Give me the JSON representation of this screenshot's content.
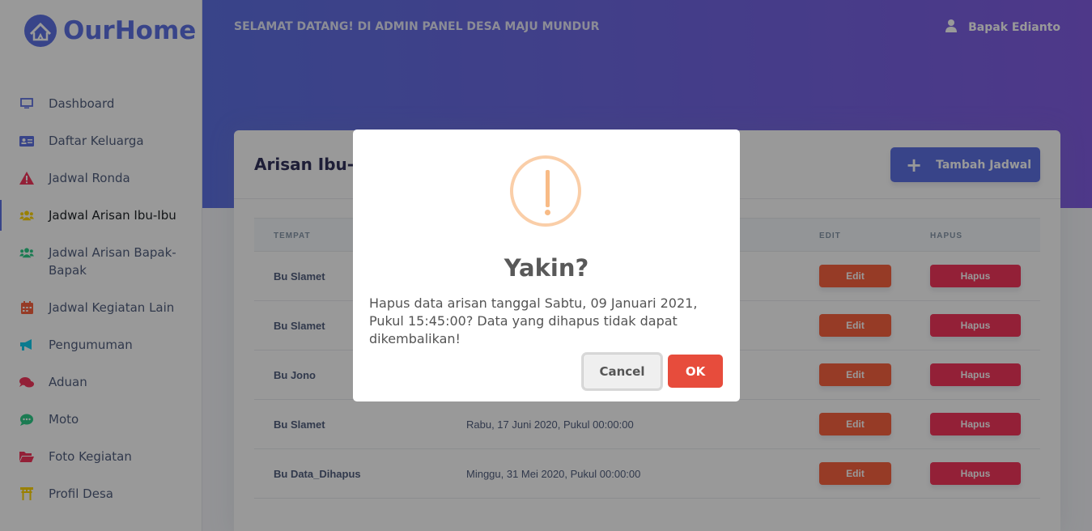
{
  "brand": {
    "name": "OurHome"
  },
  "header": {
    "welcome": "SELAMAT DATANG! DI ADMIN PANEL DESA MAJU MUNDUR",
    "user_name": "Bapak Edianto"
  },
  "sidebar": {
    "items": [
      {
        "label": "Dashboard",
        "icon": "monitor-icon",
        "color": "#5e72e4"
      },
      {
        "label": "Daftar Keluarga",
        "icon": "id-card-icon",
        "color": "#5e72e4"
      },
      {
        "label": "Jadwal Ronda",
        "icon": "warning-icon",
        "color": "#f5365c"
      },
      {
        "label": "Jadwal Arisan Ibu-Ibu",
        "icon": "users-icon",
        "color": "#ffd600"
      },
      {
        "label": "Jadwal Arisan Bapak-Bapak",
        "icon": "users-icon",
        "color": "#2dce89"
      },
      {
        "label": "Jadwal Kegiatan Lain",
        "icon": "calendar-icon",
        "color": "#fb6340"
      },
      {
        "label": "Pengumuman",
        "icon": "megaphone-icon",
        "color": "#11cdef"
      },
      {
        "label": "Aduan",
        "icon": "comments-icon",
        "color": "#f5365c"
      },
      {
        "label": "Moto",
        "icon": "comment-dots-icon",
        "color": "#2dce89"
      },
      {
        "label": "Foto Kegiatan",
        "icon": "folder-open-icon",
        "color": "#f5365c"
      },
      {
        "label": "Profil Desa",
        "icon": "torii-icon",
        "color": "#ffd600"
      }
    ],
    "active_label": "Jadwal Arisan Ibu-Ibu"
  },
  "card": {
    "title": "Arisan Ibu-Ibu",
    "add_button": "Tambah Jadwal",
    "columns": {
      "tempat": "TEMPAT",
      "edit": "EDIT",
      "hapus": "HAPUS"
    },
    "rows": [
      {
        "tempat": "Bu Slamet",
        "tanggal": "",
        "edit": "Edit",
        "hapus": "Hapus"
      },
      {
        "tempat": "Bu Slamet",
        "tanggal": "",
        "edit": "Edit",
        "hapus": "Hapus"
      },
      {
        "tempat": "Bu Jono",
        "tanggal": "",
        "edit": "Edit",
        "hapus": "Hapus"
      },
      {
        "tempat": "Bu Slamet",
        "tanggal": "Rabu, 17 Juni 2020, Pukul 00:00:00",
        "edit": "Edit",
        "hapus": "Hapus"
      },
      {
        "tempat": "Bu Data_Dihapus",
        "tanggal": "Minggu, 31 Mei 2020, Pukul 00:00:00",
        "edit": "Edit",
        "hapus": "Hapus"
      }
    ]
  },
  "dialog": {
    "title": "Yakin?",
    "message": "Hapus data arisan tanggal Sabtu, 09 Januari 2021, Pukul 15:45:00? Data yang dihapus tidak dapat dikembalikan!",
    "cancel": "Cancel",
    "ok": "OK"
  }
}
